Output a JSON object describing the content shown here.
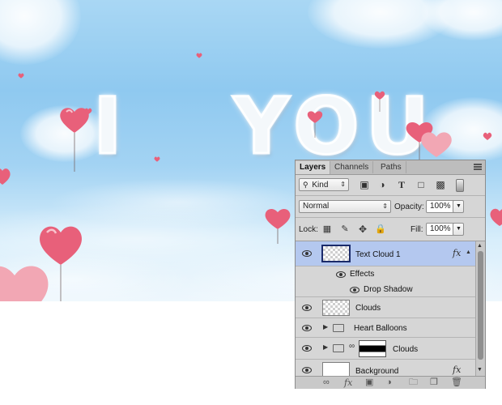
{
  "canvas": {
    "text_left": "I",
    "text_right": "YOU"
  },
  "panel": {
    "tabs": [
      "Layers",
      "Channels",
      "Paths"
    ],
    "filter": {
      "value": "Kind",
      "icon": "search-icon"
    },
    "blend_mode": "Normal",
    "opacity_label": "Opacity:",
    "opacity_value": "100%",
    "lock_label": "Lock:",
    "fill_label": "Fill:",
    "fill_value": "100%",
    "fx_label": "fx",
    "layers": [
      {
        "name": "Text Cloud 1",
        "selected": true,
        "has_fx": true
      },
      {
        "name": "Effects"
      },
      {
        "name": "Drop Shadow"
      },
      {
        "name": "Clouds"
      },
      {
        "name": "Heart Balloons",
        "type": "group"
      },
      {
        "name": "Clouds",
        "type": "group-masked"
      },
      {
        "name": "Background",
        "has_fx": true
      }
    ]
  },
  "colors": {
    "accent": "#b4c8ef",
    "balloon": "#e8607a"
  }
}
